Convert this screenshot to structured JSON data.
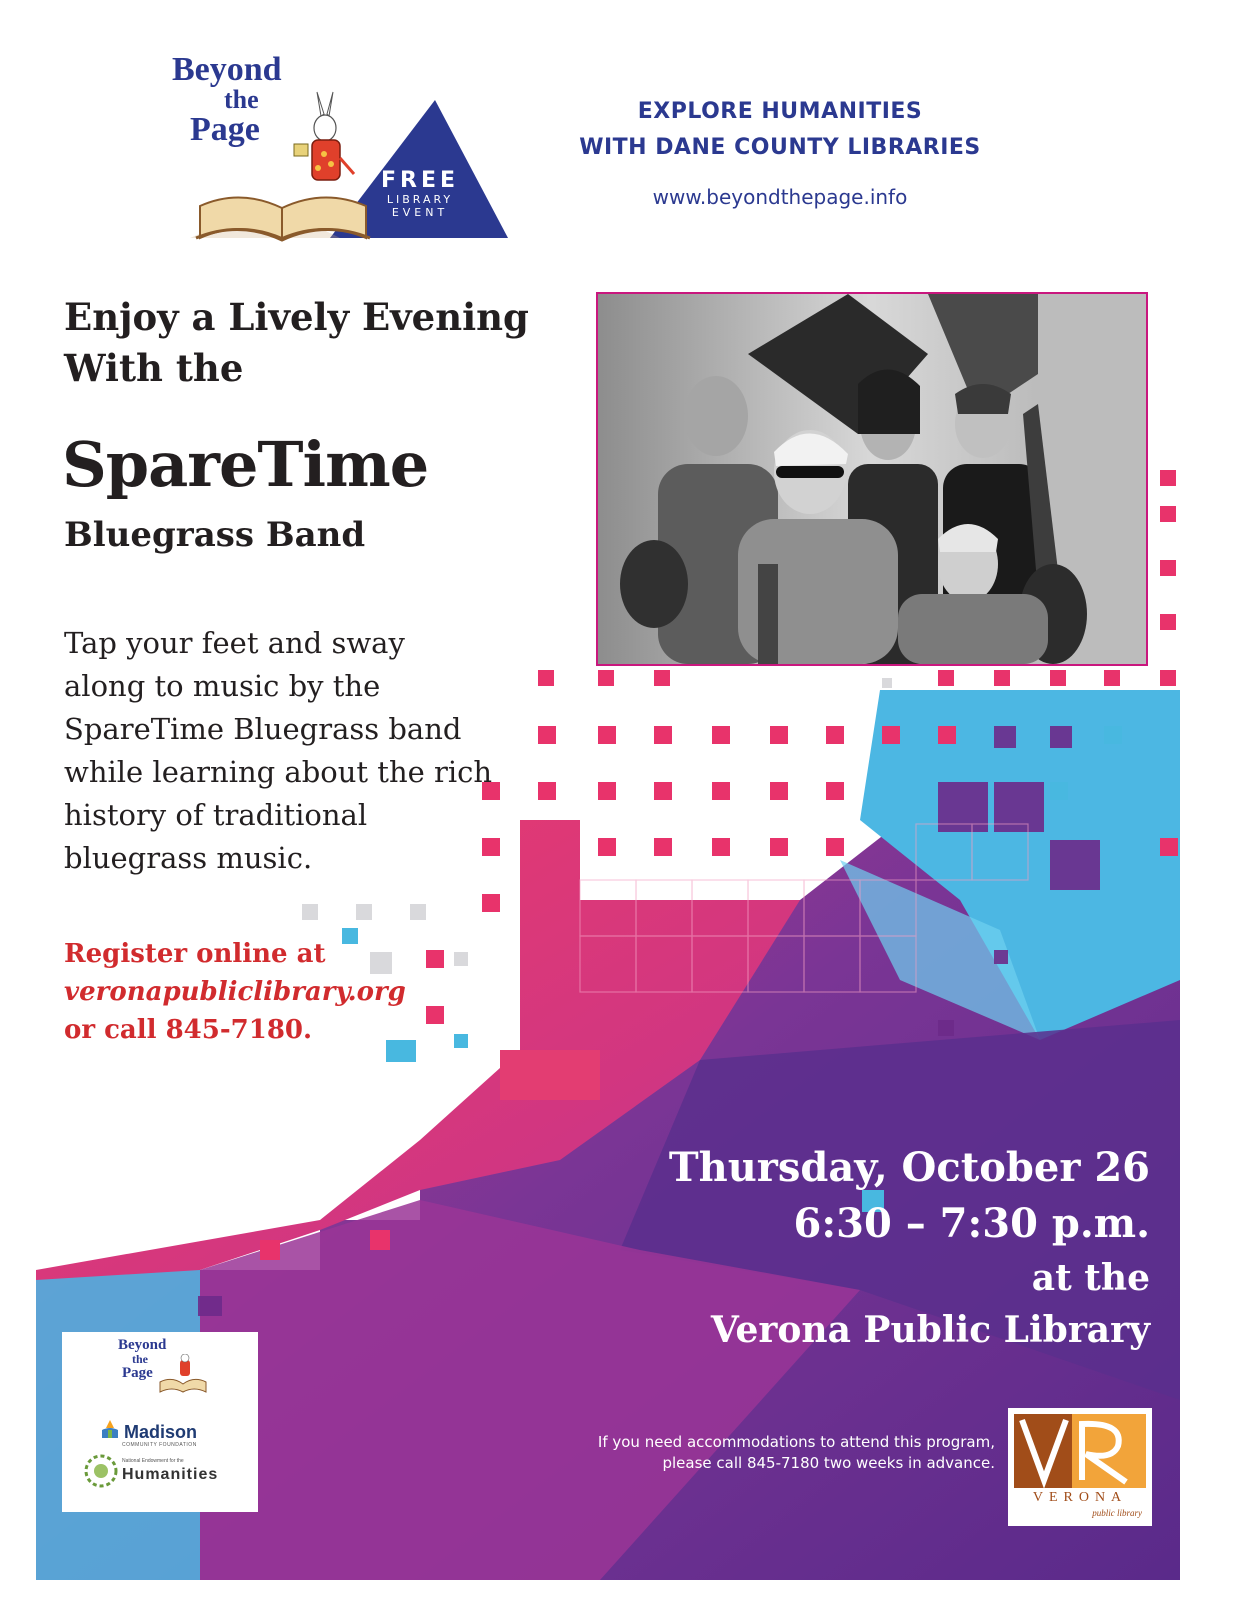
{
  "header": {
    "logo": {
      "line1": "Beyond",
      "line2": "the",
      "line3": "Page"
    },
    "badge": {
      "line1": "FREE",
      "line2": "LIBRARY",
      "line3": "EVENT"
    },
    "tagline_line1": "EXPLORE HUMANITIES",
    "tagline_line2": "WITH DANE COUNTY LIBRARIES",
    "website": "www.beyondthepage.info"
  },
  "headline": {
    "line1": "Enjoy a Lively Evening",
    "line2": "With the",
    "band_name": "SpareTime",
    "band_sub": "Bluegrass Band"
  },
  "description": {
    "line1": "Tap your feet and sway",
    "line2": "along to music by the",
    "line3": "SpareTime Bluegrass band",
    "line4": "while learning about the rich",
    "line5": "history of traditional",
    "line6": "bluegrass music."
  },
  "register": {
    "line1": "Register online at",
    "url": "veronapubliclibrary.org",
    "line3": "or call 845-7180."
  },
  "event": {
    "day": "Thursday, October 26",
    "time": "6:30 – 7:30 p.m.",
    "at": "at the",
    "venue": "Verona Public Library"
  },
  "accommodations": {
    "line1": "If you need accommodations to attend this program,",
    "line2": "please call 845-7180 two weeks in advance."
  },
  "sponsors": {
    "beyond": {
      "line1": "Beyond",
      "line2": "the",
      "line3": "Page"
    },
    "madison": "Madison",
    "madison_sub": "COMMUNITY FOUNDATION",
    "humanities_sub": "National Endowment for the",
    "humanities": "Humanities"
  },
  "verona_logo": {
    "word": "VERONA",
    "sub": "public library"
  },
  "colors": {
    "navy": "#2b3990",
    "pink": "#e8336b",
    "magenta": "#c9177e",
    "purple": "#6b2f8f",
    "cyan": "#48b8e0",
    "red_text": "#d12b2e",
    "verona_brown": "#a14d19"
  },
  "icons": [
    "book-icon",
    "white-rabbit-icon",
    "mountain-triangle-icon",
    "madison-foundation-icon",
    "humanities-emblem-icon",
    "verona-vr-monogram-icon"
  ]
}
